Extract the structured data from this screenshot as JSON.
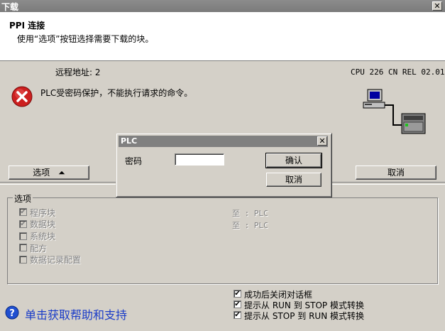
{
  "window": {
    "title": "下载"
  },
  "header": {
    "title": "PPI 连接",
    "subtitle": "使用“选项”按钮选择需要下载的块。"
  },
  "info": {
    "remote_address": "远程地址: 2",
    "cpu": "CPU 226 CN REL 02.01"
  },
  "error": {
    "message": "PLC受密码保护，不能执行请求的命令。"
  },
  "buttons": {
    "options": "选项",
    "options_arrow": "⏶",
    "cancel": "取消"
  },
  "options_group": {
    "label": "选项",
    "items": [
      {
        "label": "程序块",
        "checked": true,
        "dest": "至 : PLC"
      },
      {
        "label": "数据块",
        "checked": true,
        "dest": "至 : PLC"
      },
      {
        "label": "系统块",
        "checked": false,
        "dest": ""
      },
      {
        "label": "配方",
        "checked": false,
        "dest": ""
      },
      {
        "label": "数据记录配置",
        "checked": false,
        "dest": ""
      }
    ]
  },
  "bottom_options": [
    {
      "label": "成功后关闭对话框",
      "checked": true
    },
    {
      "label": "提示从 RUN 到 STOP 模式转换",
      "checked": true
    },
    {
      "label": "提示从 STOP 到 RUN 模式转换",
      "checked": true
    }
  ],
  "help": {
    "label": "单击获取帮助和支持"
  },
  "password_dialog": {
    "title": "PLC",
    "password_label": "密码",
    "password_value": "",
    "ok": "确认",
    "cancel": "取消"
  },
  "colors": {
    "help_text": "#1a3cc8",
    "error_icon": "#cc1f1f"
  }
}
